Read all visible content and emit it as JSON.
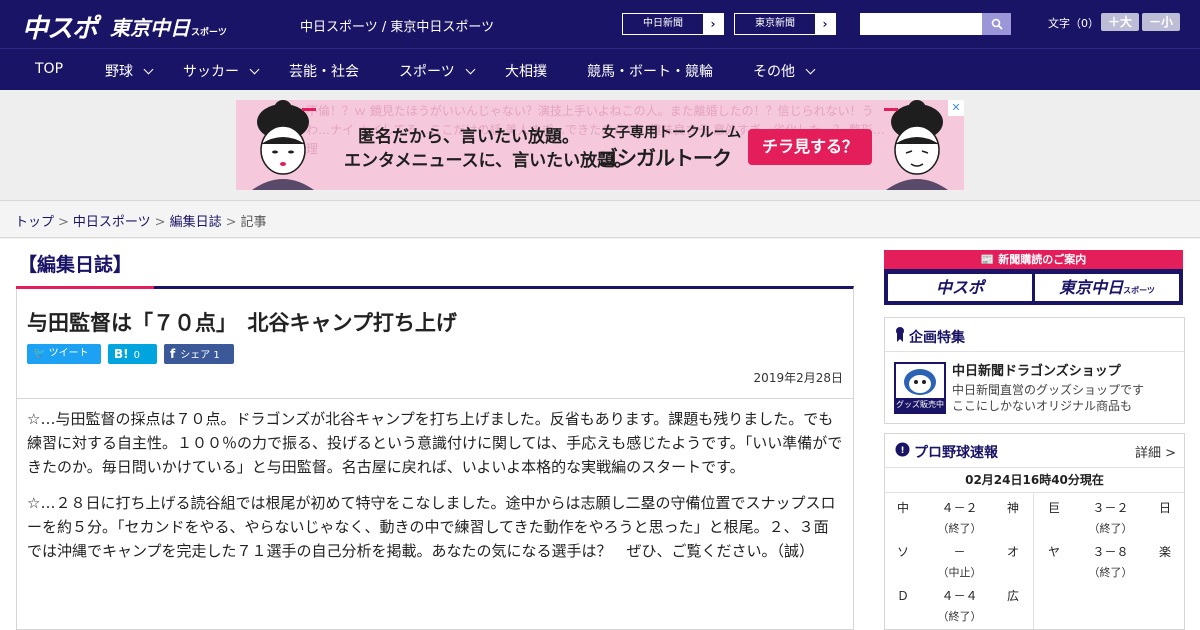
{
  "header": {
    "logo_chuspo": "中スポ",
    "logo_tokyo": "東京中日",
    "logo_tokyo_suffix": "スポーツ",
    "site_names": "中日スポーツ / 東京中日スポーツ",
    "btn_chunichi": "中日新聞",
    "btn_tokyo": "東京新聞",
    "search_placeholder": "",
    "font_size_label": "文字（0）",
    "font_up": "＋大",
    "font_down": "－小"
  },
  "nav": {
    "items": [
      {
        "label": "TOP"
      },
      {
        "label": "野球"
      },
      {
        "label": "サッカー"
      },
      {
        "label": "芸能・社会"
      },
      {
        "label": "スポーツ"
      },
      {
        "label": "大相撲"
      },
      {
        "label": "競馬・ボート・競輪"
      },
      {
        "label": "その他"
      }
    ]
  },
  "ad": {
    "bg_text": "不倫！？ｗ 鏡見たほうがいいんじゃない？演技上手いよねこの人。また離婚したの！？信じられない！うわ…ナイ ナイしてる…ここだけの話 美人すぎ…できたのかな？趣味良さそ 意外すぎ…劣化した…？ 整形…理",
    "title1": "匿名だから、言いたい放題。",
    "title2": "エンタメニュースに、言いたい放題。",
    "sub": "女子専用トークルーム",
    "brand": "ゴシガルトーク",
    "cta": "チラ見する？",
    "close": "✕"
  },
  "breadcrumb": {
    "items": [
      "トップ",
      "中日スポーツ",
      "編集日誌"
    ],
    "current": "記事",
    "sep": ">"
  },
  "article": {
    "section": "【編集日誌】",
    "title": "与田監督は「７０点」　北谷キャンプ打ち上げ",
    "share_twitter": "ツイート",
    "share_hatena_count": "0",
    "share_facebook": "シェア",
    "share_facebook_count": "1",
    "date": "2019年2月28日",
    "paragraphs": [
      "☆…与田監督の採点は７０点。ドラゴンズが北谷キャンプを打ち上げました。反省もあります。課題も残りました。でも練習に対する自主性。１００％の力で振る、投げるという意識付けに関しては、手応えも感じたようです。「いい準備ができたのか。毎日問いかけている」と与田監督。名古屋に戻れば、いよいよ本格的な実戦編のスタートです。",
      "☆…２８日に打ち上げる読谷組では根尾が初めて特守をこなしました。途中からは志願し二塁の守備位置でスナップスローを約５分。「セカンドをやる、やらないじゃなく、動きの中で練習してきた動作をやろうと思った」と根尾。２、３面では沖縄でキャンプを完走した７１選手の自己分析を掲載。あなたの気になる選手は？　ぜひ、ご覧ください。（誠）"
    ]
  },
  "sidebar": {
    "subscribe_head": "新聞購読のご案内",
    "subscribe_chuspo": "中スポ",
    "subscribe_tokyo": "東京中日",
    "subscribe_tokyo_suffix": "スポーツ",
    "feature_head": "企画特集",
    "feature_thumb_label": "グッズ販売中",
    "feature_name": "中日新聞ドラゴンズショップ",
    "feature_desc1": "中日新聞直営のグッズショップです",
    "feature_desc2": "ここにしかないオリジナル商品も",
    "score_head": "プロ野球速報",
    "score_detail": "詳細 >",
    "score_time": "02月24日16時40分現在",
    "games_left": [
      {
        "home": "中",
        "score": "４－２",
        "away": "神",
        "status": "（終了）"
      },
      {
        "home": "ソ",
        "score": "－",
        "away": "オ",
        "status": "（中止）"
      },
      {
        "home": "Ｄ",
        "score": "４－４",
        "away": "広",
        "status": "（終了）"
      }
    ],
    "games_right": [
      {
        "home": "巨",
        "score": "３－２",
        "away": "日",
        "status": "（終了）"
      },
      {
        "home": "ヤ",
        "score": "３－８",
        "away": "楽",
        "status": "（終了）"
      }
    ]
  },
  "colors": {
    "brand_navy": "#1a1466",
    "accent_pink": "#e41e5a"
  }
}
